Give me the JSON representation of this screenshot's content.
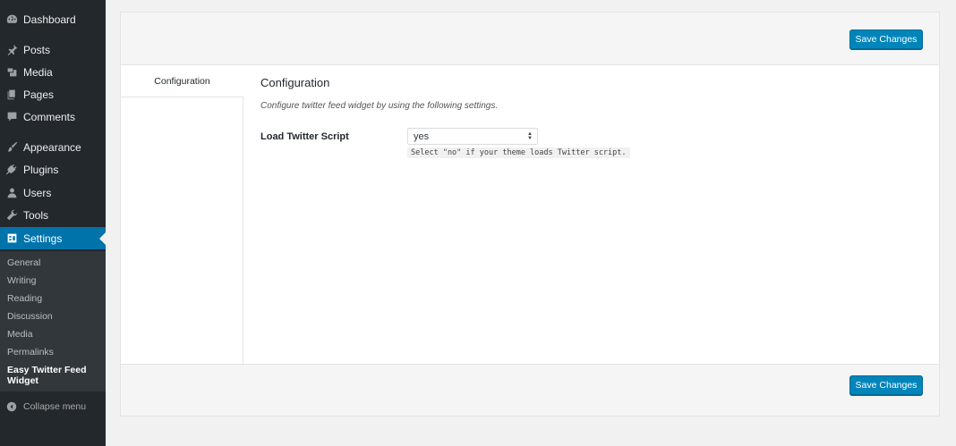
{
  "sidebar": {
    "items": [
      {
        "label": "Dashboard",
        "icon": "dashboard-icon"
      },
      {
        "label": "Posts",
        "icon": "pin-icon"
      },
      {
        "label": "Media",
        "icon": "media-icon"
      },
      {
        "label": "Pages",
        "icon": "pages-icon"
      },
      {
        "label": "Comments",
        "icon": "comment-icon"
      },
      {
        "label": "Appearance",
        "icon": "brush-icon"
      },
      {
        "label": "Plugins",
        "icon": "plug-icon"
      },
      {
        "label": "Users",
        "icon": "user-icon"
      },
      {
        "label": "Tools",
        "icon": "wrench-icon"
      },
      {
        "label": "Settings",
        "icon": "settings-icon"
      }
    ],
    "submenu": [
      "General",
      "Writing",
      "Reading",
      "Discussion",
      "Media",
      "Permalinks",
      "Easy Twitter Feed Widget"
    ],
    "collapse_label": "Collapse menu"
  },
  "header": {
    "save_label": "Save Changes"
  },
  "footer": {
    "save_label": "Save Changes"
  },
  "tabs": [
    "Configuration"
  ],
  "main": {
    "title": "Configuration",
    "description": "Configure twitter feed widget by using the following settings.",
    "field": {
      "label": "Load Twitter Script",
      "value": "yes",
      "hint": "Select \"no\" if your theme loads Twitter script."
    }
  },
  "colors": {
    "accent": "#0073aa",
    "sidebar_bg": "#23282d",
    "button": "#0085ba"
  }
}
